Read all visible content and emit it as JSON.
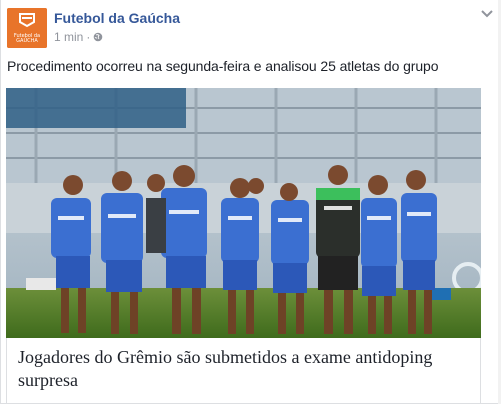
{
  "post": {
    "page_name": "Futebol da Gaúcha",
    "timestamp": "1 min",
    "separator": "·",
    "privacy_icon": "globe-icon",
    "menu_icon": "chevron-down-icon",
    "text": "Procedimento ocorreu na segunda-feira e analisou 25 atletas do grupo",
    "avatar_text": "Futebol da GAÚCHA"
  },
  "link": {
    "title": "Jogadores do Grêmio são submetidos a exame antidoping surpresa"
  },
  "colors": {
    "page_name": "#365899",
    "meta": "#90949c",
    "avatar_bg": "#e8742a",
    "text": "#1d2129"
  }
}
